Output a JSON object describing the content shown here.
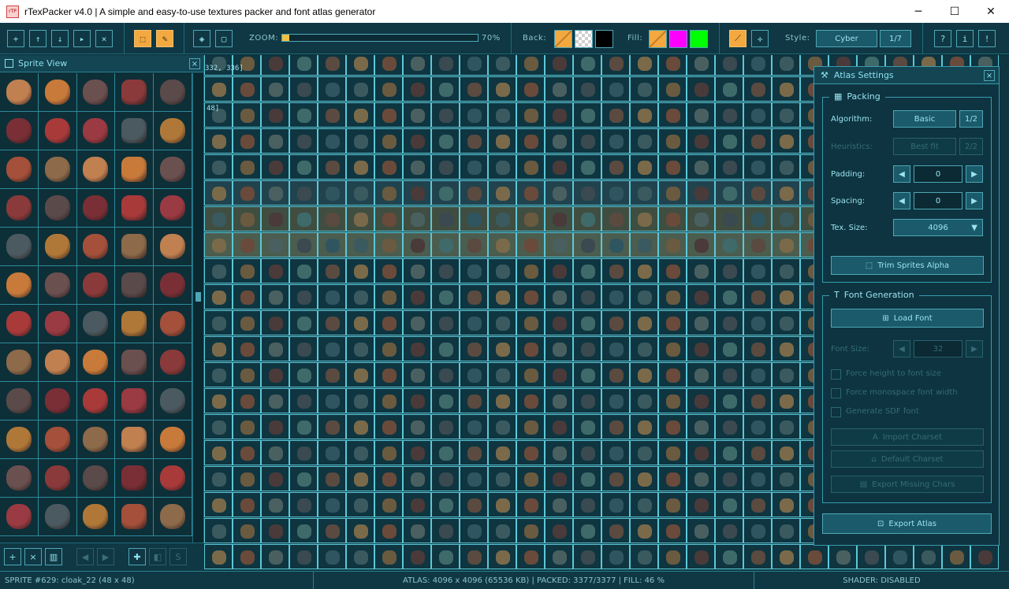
{
  "window": {
    "title": "rTexPacker v4.0 | A simple and easy-to-use textures packer and font atlas generator",
    "app_icon_text": "rTP",
    "minimize": "─",
    "maximize": "☐",
    "close": "✕"
  },
  "toolbar": {
    "file_buttons": [
      "new-icon",
      "load-icon",
      "save-icon",
      "export-icon",
      "close-icon"
    ],
    "zoom_label": "ZOOM:",
    "zoom_value": "70%",
    "zoom_fraction": 0.035,
    "back_label": "Back:",
    "fill_label": "Fill:",
    "style_label": "Style:",
    "style_value": "Cyber",
    "style_count": "1/7",
    "help": "?",
    "info": "i",
    "warn": "!",
    "back_colors": [
      "#f3a940",
      "checker",
      "#000000"
    ],
    "fill_colors": [
      "#f3a940",
      "#ff00ff",
      "#00ff00"
    ]
  },
  "sprite_view": {
    "title": "Sprite View",
    "close": "×"
  },
  "settings": {
    "title": "Atlas Settings",
    "close": "×",
    "packing": {
      "title": "Packing",
      "algorithm_label": "Algorithm:",
      "algorithm_value": "Basic",
      "algorithm_count": "1/2",
      "heuristics_label": "Heuristics:",
      "heuristics_value": "Best fit",
      "heuristics_count": "2/2",
      "padding_label": "Padding:",
      "padding_value": "0",
      "spacing_label": "Spacing:",
      "spacing_value": "0",
      "texsize_label": "Tex. Size:",
      "texsize_value": "4096",
      "trim_button": "Trim Sprites Alpha"
    },
    "font": {
      "title": "Font Generation",
      "load_button": "Load Font",
      "fontsize_label": "Font Size:",
      "fontsize_value": "32",
      "check1": "Force height to font size",
      "check2": "Force monospace font width",
      "check3": "Generate SDF font",
      "import_button": "Import Charset",
      "default_button": "Default Charset",
      "export_missing_button": "Export Missing Chars"
    },
    "export_button": "Export Atlas"
  },
  "atlas": {
    "label1": "332, 336]",
    "label2": "48]"
  },
  "status": {
    "sprite": "SPRITE #629: cloak_22 (48 x 48)",
    "atlas": "ATLAS: 4096 x 4096 (65536 KB)  |  PACKED: 3377/3377  |  FILL: 46 %",
    "shader": "SHADER: DISABLED"
  },
  "colors": {
    "accent": "#f3a940",
    "grid": "#5cc8d8",
    "panel": "#0d3440"
  }
}
